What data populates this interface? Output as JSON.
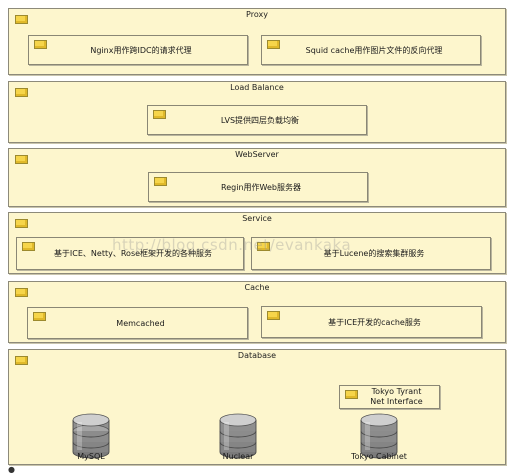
{
  "layers": {
    "proxy": {
      "title": "Proxy",
      "components": [
        "Nginx用作跨IDC的请求代理",
        "Squid cache用作图片文件的反向代理"
      ]
    },
    "load_balance": {
      "title": "Load Balance",
      "components": [
        "LVS提供四层负载均衡"
      ]
    },
    "webserver": {
      "title": "WebServer",
      "components": [
        "Regin用作Web服务器"
      ]
    },
    "service": {
      "title": "Service",
      "components": [
        "基于ICE、Netty、Rose框架开发的各种服务",
        "基于Lucene的搜索集群服务"
      ]
    },
    "cache": {
      "title": "Cache",
      "components": [
        "Memcached",
        "基于ICE开发的cache服务"
      ]
    },
    "database": {
      "title": "Database",
      "components": [
        "Tokyo Tyrant\nNet Interface"
      ],
      "stores": [
        "MySQL",
        "Nuclear",
        "Tokyo Cabinet"
      ]
    }
  },
  "watermark": "http://blog.csdn.net/evankaka",
  "icons": {
    "component_flag": "yellow-component-flag-icon",
    "database": "database-cylinder-icon"
  },
  "colors": {
    "layer_fill": "#fdf6cd",
    "border": "#8d8a7a",
    "flag": "#f6d54a",
    "db_gray": "#8f8f8f"
  }
}
